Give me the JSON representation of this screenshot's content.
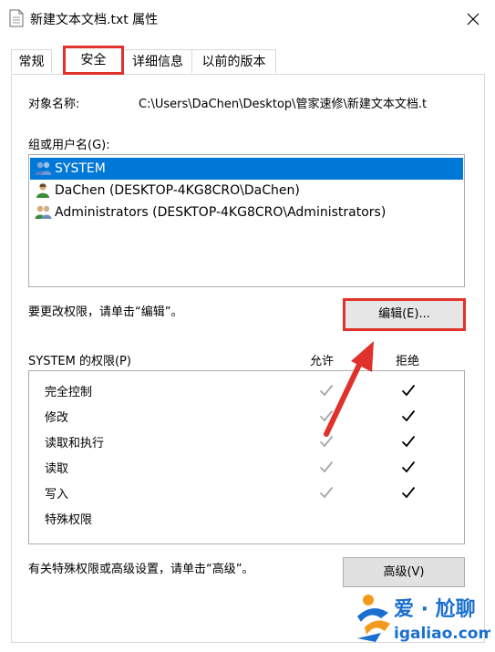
{
  "window": {
    "title": "新建文本文档.txt 属性"
  },
  "tabs": [
    {
      "label": "常规"
    },
    {
      "label": "安全"
    },
    {
      "label": "详细信息"
    },
    {
      "label": "以前的版本"
    }
  ],
  "security": {
    "object_label": "对象名称:",
    "object_value": "C:\\Users\\DaChen\\Desktop\\管家速修\\新建文本文档.t",
    "groups_label": "组或用户名(G):",
    "users": [
      {
        "name": "SYSTEM",
        "icon": "user-group-icon"
      },
      {
        "name": "DaChen (DESKTOP-4KG8CRO\\DaChen)",
        "icon": "user-icon"
      },
      {
        "name": "Administrators (DESKTOP-4KG8CRO\\Administrators)",
        "icon": "user-group-icon"
      }
    ],
    "change_hint": "要更改权限，请单击“编辑”。",
    "edit_button": "编辑(E)...",
    "perm_title": "SYSTEM 的权限(P)",
    "allow_header": "允许",
    "deny_header": "拒绝",
    "permissions": [
      {
        "name": "完全控制",
        "allow": "gray",
        "deny": "black"
      },
      {
        "name": "修改",
        "allow": "gray",
        "deny": "black"
      },
      {
        "name": "读取和执行",
        "allow": "gray",
        "deny": "black"
      },
      {
        "name": "读取",
        "allow": "gray",
        "deny": "black"
      },
      {
        "name": "写入",
        "allow": "gray",
        "deny": "black"
      },
      {
        "name": "特殊权限",
        "allow": "none",
        "deny": "none"
      }
    ],
    "advanced_hint": "有关特殊权限或高级设置，请单击“高级”。",
    "advanced_button": "高级(V)"
  },
  "watermark": {
    "brand": "爱 · 尬聊",
    "domain": "igaliao.com"
  },
  "colors": {
    "highlight": "#e0322b",
    "selection": "#0078d7",
    "brand_blue": "#1a6fd0",
    "brand_orange": "#f39a1e"
  }
}
